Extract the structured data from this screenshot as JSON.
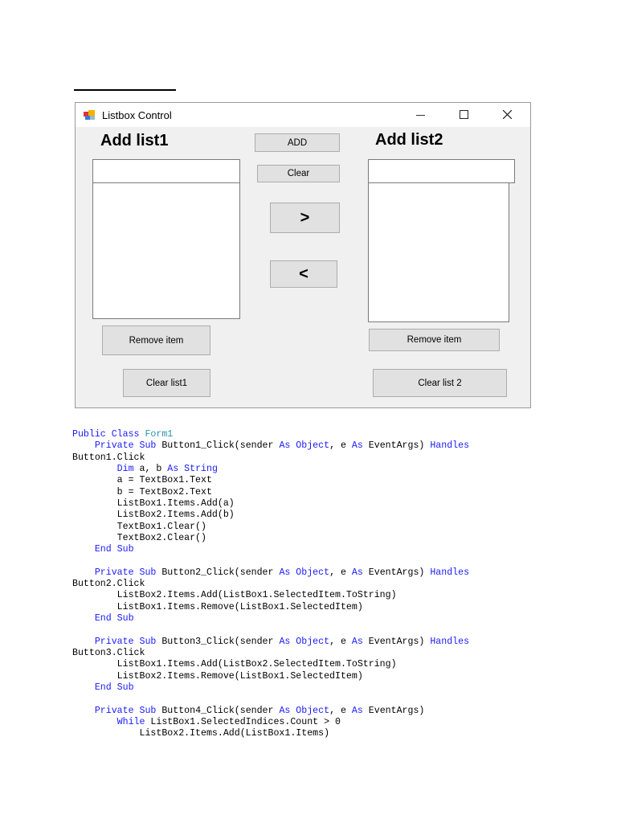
{
  "window": {
    "title": "Listbox Control",
    "label1": "Add list1",
    "label2": "Add list2",
    "add_button": "ADD",
    "clear_button": "Clear",
    "move_right_button": ">",
    "move_left_button": "<",
    "remove_item1_button": "Remove item",
    "remove_item2_button": "Remove item",
    "clear_list1_button": "Clear list1",
    "clear_list2_button": "Clear list 2",
    "textbox1_value": "",
    "textbox2_value": ""
  },
  "code": [
    [
      [
        "Public Class ",
        "kw"
      ],
      [
        "Form1",
        "ty"
      ]
    ],
    [
      [
        "    Private Sub ",
        "kw"
      ],
      [
        "Button1_Click(sender ",
        ""
      ],
      [
        "As Object",
        "kw"
      ],
      [
        ", e ",
        ""
      ],
      [
        "As",
        "kw"
      ],
      [
        " EventArgs) ",
        ""
      ],
      [
        "Handles",
        "kw"
      ]
    ],
    [
      [
        "Button1.Click",
        ""
      ]
    ],
    [
      [
        "        Dim",
        "kw"
      ],
      [
        " a, b ",
        ""
      ],
      [
        "As String",
        "kw"
      ]
    ],
    [
      [
        "        a = TextBox1.Text",
        ""
      ]
    ],
    [
      [
        "        b = TextBox2.Text",
        ""
      ]
    ],
    [
      [
        "        ListBox1.Items.Add(a)",
        ""
      ]
    ],
    [
      [
        "        ListBox2.Items.Add(b)",
        ""
      ]
    ],
    [
      [
        "        TextBox1.Clear()",
        ""
      ]
    ],
    [
      [
        "        TextBox2.Clear()",
        ""
      ]
    ],
    [
      [
        "    End Sub",
        "kw"
      ]
    ],
    [],
    [
      [
        "    Private Sub ",
        "kw"
      ],
      [
        "Button2_Click(sender ",
        ""
      ],
      [
        "As Object",
        "kw"
      ],
      [
        ", e ",
        ""
      ],
      [
        "As",
        "kw"
      ],
      [
        " EventArgs) ",
        ""
      ],
      [
        "Handles",
        "kw"
      ]
    ],
    [
      [
        "Button2.Click",
        ""
      ]
    ],
    [
      [
        "        ListBox2.Items.Add(ListBox1.SelectedItem.ToString)",
        ""
      ]
    ],
    [
      [
        "        ListBox1.Items.Remove(ListBox1.SelectedItem)",
        ""
      ]
    ],
    [
      [
        "    End Sub",
        "kw"
      ]
    ],
    [],
    [
      [
        "    Private Sub ",
        "kw"
      ],
      [
        "Button3_Click(sender ",
        ""
      ],
      [
        "As Object",
        "kw"
      ],
      [
        ", e ",
        ""
      ],
      [
        "As",
        "kw"
      ],
      [
        " EventArgs) ",
        ""
      ],
      [
        "Handles",
        "kw"
      ]
    ],
    [
      [
        "Button3.Click",
        ""
      ]
    ],
    [
      [
        "        ListBox1.Items.Add(ListBox2.SelectedItem.ToString)",
        ""
      ]
    ],
    [
      [
        "        ListBox2.Items.Remove(ListBox1.SelectedItem)",
        ""
      ]
    ],
    [
      [
        "    End Sub",
        "kw"
      ]
    ],
    [],
    [
      [
        "    Private Sub ",
        "kw"
      ],
      [
        "Button4_Click(sender ",
        ""
      ],
      [
        "As Object",
        "kw"
      ],
      [
        ", e ",
        ""
      ],
      [
        "As",
        "kw"
      ],
      [
        " EventArgs)",
        ""
      ]
    ],
    [
      [
        "        While",
        "kw"
      ],
      [
        " ListBox1.SelectedIndices.Count > 0",
        ""
      ]
    ],
    [
      [
        "            ListBox2.Items.Add(ListBox1.Items)",
        ""
      ]
    ]
  ]
}
